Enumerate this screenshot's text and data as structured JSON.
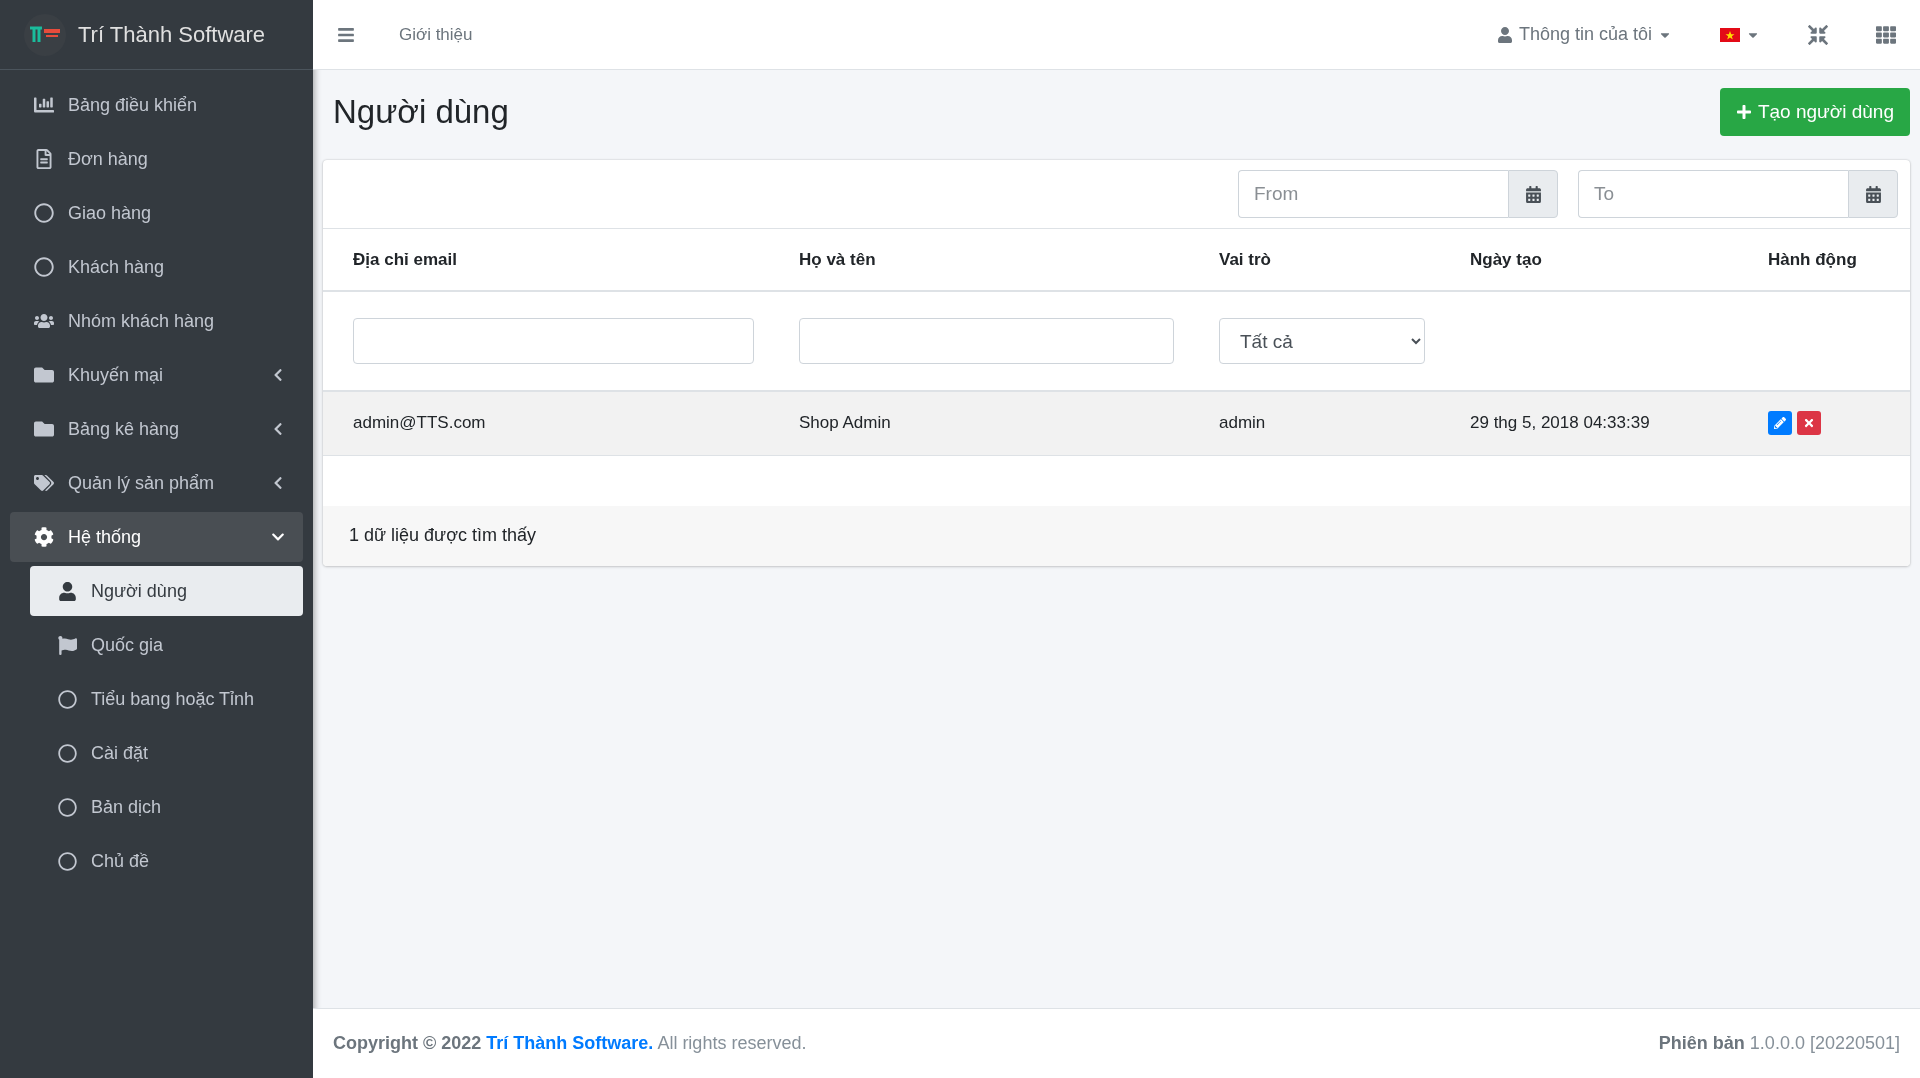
{
  "brand": {
    "name": "Trí Thành Software"
  },
  "sidebar": {
    "items": [
      {
        "label": "Bảng điều khiển",
        "selected": false
      },
      {
        "label": "Đơn hàng",
        "selected": false
      },
      {
        "label": "Giao hàng",
        "selected": false
      },
      {
        "label": "Khách hàng",
        "selected": false
      },
      {
        "label": "Nhóm khách hàng",
        "selected": false
      },
      {
        "label": "Khuyến mại",
        "selected": false,
        "expanded": false
      },
      {
        "label": "Bảng kê hàng",
        "selected": false,
        "expanded": false
      },
      {
        "label": "Quản lý sản phẩm",
        "selected": false,
        "expanded": false
      },
      {
        "label": "Hệ thống",
        "selected": true,
        "expanded": true,
        "children": [
          {
            "label": "Người dùng",
            "selected": true
          },
          {
            "label": "Quốc gia",
            "selected": false
          },
          {
            "label": "Tiểu bang hoặc Tỉnh",
            "selected": false
          },
          {
            "label": "Cài đặt",
            "selected": false
          },
          {
            "label": "Bản dịch",
            "selected": false
          },
          {
            "label": "Chủ đề",
            "selected": false
          }
        ]
      }
    ]
  },
  "topbar": {
    "nav_link": "Giới thiệu",
    "user_menu": "Thông tin của tôi"
  },
  "page": {
    "title": "Người dùng",
    "create_button": "Tạo người dùng"
  },
  "filters": {
    "from": {
      "placeholder": "From"
    },
    "to": {
      "placeholder": "To"
    }
  },
  "table": {
    "columns": [
      "Địa chỉ email",
      "Họ và tên",
      "Vai trò",
      "Ngày tạo",
      "Hành động"
    ],
    "role_filter": "Tất cả",
    "rows": [
      {
        "email": "admin@TTS.com",
        "name": "Shop Admin",
        "role": "admin",
        "created": "29 thg 5, 2018 04:33:39"
      }
    ],
    "summary": "1 dữ liệu được tìm thấy"
  },
  "footer": {
    "copyright_prefix": "Copyright © 2022",
    "company": "Trí Thành Software.",
    "rights": "All rights reserved.",
    "version_label": "Phiên bản",
    "version": "1.0.0.0 [20220501]"
  }
}
